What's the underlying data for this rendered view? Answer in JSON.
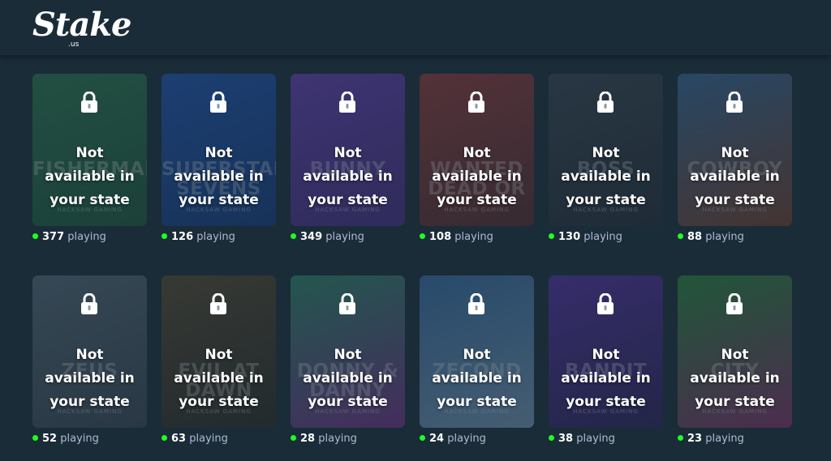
{
  "header": {
    "logo_text": "Stake",
    "logo_suffix": ".us"
  },
  "lock_message": {
    "line1": "Not",
    "line2": "available in",
    "line3": "your state"
  },
  "games": [
    {
      "title": "FISHERMAN",
      "provider": "HACKSAW GAMING",
      "players": "377",
      "players_label": "playing",
      "color": "#2f7a4f",
      "color2": "#1d5a3a"
    },
    {
      "title": "SUPERSTAR SEVENS",
      "provider": "HACKSAW GAMING",
      "players": "126",
      "players_label": "playing",
      "color": "#1f56b8",
      "color2": "#153b80"
    },
    {
      "title": "BUNNY",
      "provider": "HACKSAW GAMING",
      "players": "349",
      "players_label": "playing",
      "color": "#6a3fb8",
      "color2": "#4b2c86"
    },
    {
      "title": "WANTED DEAD OR",
      "provider": "HACKSAW GAMING",
      "players": "108",
      "players_label": "playing",
      "color": "#9b3a3a",
      "color2": "#5b2a2a"
    },
    {
      "title": "BOSS",
      "provider": "HACKSAW GAMING",
      "players": "130",
      "players_label": "playing",
      "color": "#3c4552",
      "color2": "#262d36"
    },
    {
      "title": "COWBOY",
      "provider": "HACKSAW GAMING",
      "players": "88",
      "players_label": "playing",
      "color": "#3a6a9a",
      "color2": "#7a3f2a"
    },
    {
      "title": "ZEUS",
      "provider": "HACKSAW GAMING",
      "players": "52",
      "players_label": "playing",
      "color": "#5a6a78",
      "color2": "#3c4753"
    },
    {
      "title": "EVIL AT DAWN",
      "provider": "HACKSAW GAMING",
      "players": "63",
      "players_label": "playing",
      "color": "#5b4a2e",
      "color2": "#2e2a22"
    },
    {
      "title": "DONNY & DANNY",
      "provider": "HACKSAW GAMING",
      "players": "28",
      "players_label": "playing",
      "color": "#2f8a6a",
      "color2": "#7a2f8a"
    },
    {
      "title": "ZECOND",
      "provider": "HACKSAW GAMING",
      "players": "24",
      "players_label": "playing",
      "color": "#3a6fa8",
      "color2": "#7a9ab8"
    },
    {
      "title": "BANDIT",
      "provider": "HACKSAW GAMING",
      "players": "38",
      "players_label": "playing",
      "color": "#5a2fa8",
      "color2": "#2e1f5a"
    },
    {
      "title": "CITY",
      "provider": "HACKSAW GAMING",
      "players": "23",
      "players_label": "playing",
      "color": "#2a8a3a",
      "color2": "#8a2f6a"
    }
  ]
}
